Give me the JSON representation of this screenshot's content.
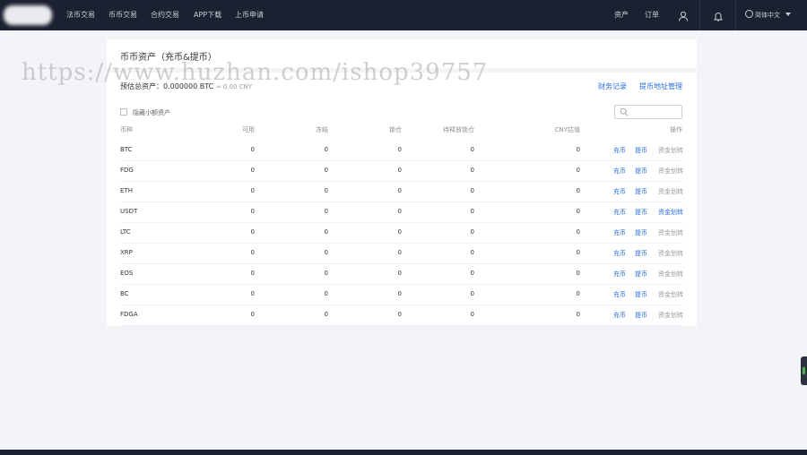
{
  "nav": {
    "items": [
      "法币交易",
      "币币交易",
      "合约交易",
      "APP下载",
      "上币申请"
    ],
    "assets": "资产",
    "orders": "订单",
    "language": "简体中文"
  },
  "page": {
    "title": "币币资产（充币&提币）",
    "estimate_label": "预估总资产：",
    "estimate_btc": "0.000000 BTC",
    "estimate_cny": "≈ 0.00 CNY",
    "link_finance": "财务记录",
    "link_address": "提币地址管理",
    "hide_small": "隐藏小额资产"
  },
  "table": {
    "headers": [
      "币种",
      "可用",
      "冻结",
      "锁仓",
      "待释放锁仓",
      "CNY估值",
      "操作"
    ],
    "rows": [
      {
        "coin": "BTC",
        "available": "0",
        "frozen": "0",
        "locked": "0",
        "pending": "0",
        "cny": "0",
        "deposit": "充币",
        "withdraw": "提币",
        "transfer": "资金划转",
        "transfer_active": false
      },
      {
        "coin": "FDG",
        "available": "0",
        "frozen": "0",
        "locked": "0",
        "pending": "0",
        "cny": "0",
        "deposit": "充币",
        "withdraw": "提币",
        "transfer": "资金划转",
        "transfer_active": false
      },
      {
        "coin": "ETH",
        "available": "0",
        "frozen": "0",
        "locked": "0",
        "pending": "0",
        "cny": "0",
        "deposit": "充币",
        "withdraw": "提币",
        "transfer": "资金划转",
        "transfer_active": false
      },
      {
        "coin": "USDT",
        "available": "0",
        "frozen": "0",
        "locked": "0",
        "pending": "0",
        "cny": "0",
        "deposit": "充币",
        "withdraw": "提币",
        "transfer": "资金划转",
        "transfer_active": true
      },
      {
        "coin": "LTC",
        "available": "0",
        "frozen": "0",
        "locked": "0",
        "pending": "0",
        "cny": "0",
        "deposit": "充币",
        "withdraw": "提币",
        "transfer": "资金划转",
        "transfer_active": false
      },
      {
        "coin": "XRP",
        "available": "0",
        "frozen": "0",
        "locked": "0",
        "pending": "0",
        "cny": "0",
        "deposit": "充币",
        "withdraw": "提币",
        "transfer": "资金划转",
        "transfer_active": false
      },
      {
        "coin": "EOS",
        "available": "0",
        "frozen": "0",
        "locked": "0",
        "pending": "0",
        "cny": "0",
        "deposit": "充币",
        "withdraw": "提币",
        "transfer": "资金划转",
        "transfer_active": false
      },
      {
        "coin": "BC",
        "available": "0",
        "frozen": "0",
        "locked": "0",
        "pending": "0",
        "cny": "0",
        "deposit": "充币",
        "withdraw": "提币",
        "transfer": "资金划转",
        "transfer_active": false
      },
      {
        "coin": "FDGA",
        "available": "0",
        "frozen": "0",
        "locked": "0",
        "pending": "0",
        "cny": "0",
        "deposit": "充币",
        "withdraw": "提币",
        "transfer": "资金划转",
        "transfer_active": false
      }
    ]
  },
  "watermark": "https://www.huzhan.com/ishop39757",
  "colors": {
    "topbar": "#1b2130",
    "link": "#2a6ee0",
    "background": "#f3f4f7"
  }
}
